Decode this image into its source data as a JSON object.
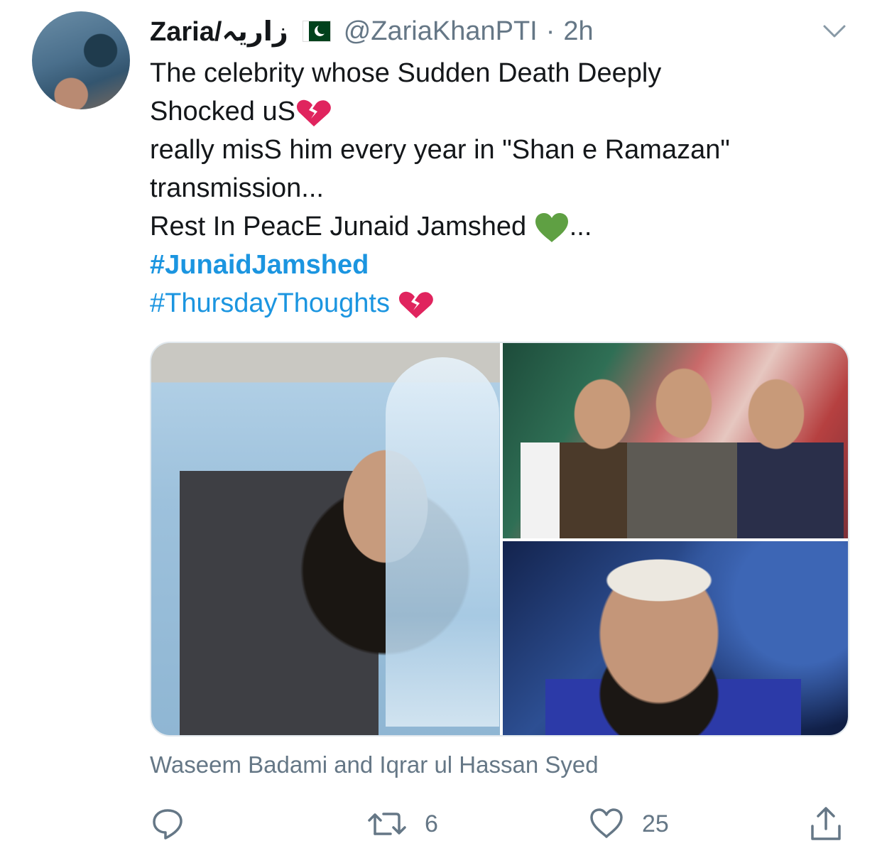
{
  "tweet": {
    "author_name": "Zaria/زاریہ",
    "flag": "pakistan-flag-icon",
    "handle": "@ZariaKhanPTI",
    "separator": "·",
    "time": "2h",
    "lines": [
      "The celebrity whose Sudden Death Deeply",
      "Shocked uS",
      "really misS him every year in  \"Shan e Ramazan\"",
      "transmission...",
      "Rest In PeacE Junaid Jamshed ",
      "...",
      "#JunaidJamshed",
      "#ThursdayThoughts"
    ],
    "caption": "Waseem Badami and Iqrar ul Hassan Syed",
    "reply_icon": "reply-icon",
    "retweet_count": "6",
    "like_count": "25",
    "colors": {
      "link": "#1b95e0",
      "muted": "#657786",
      "broken_heart": "#e0245e",
      "green_heart": "#5fa043"
    }
  }
}
